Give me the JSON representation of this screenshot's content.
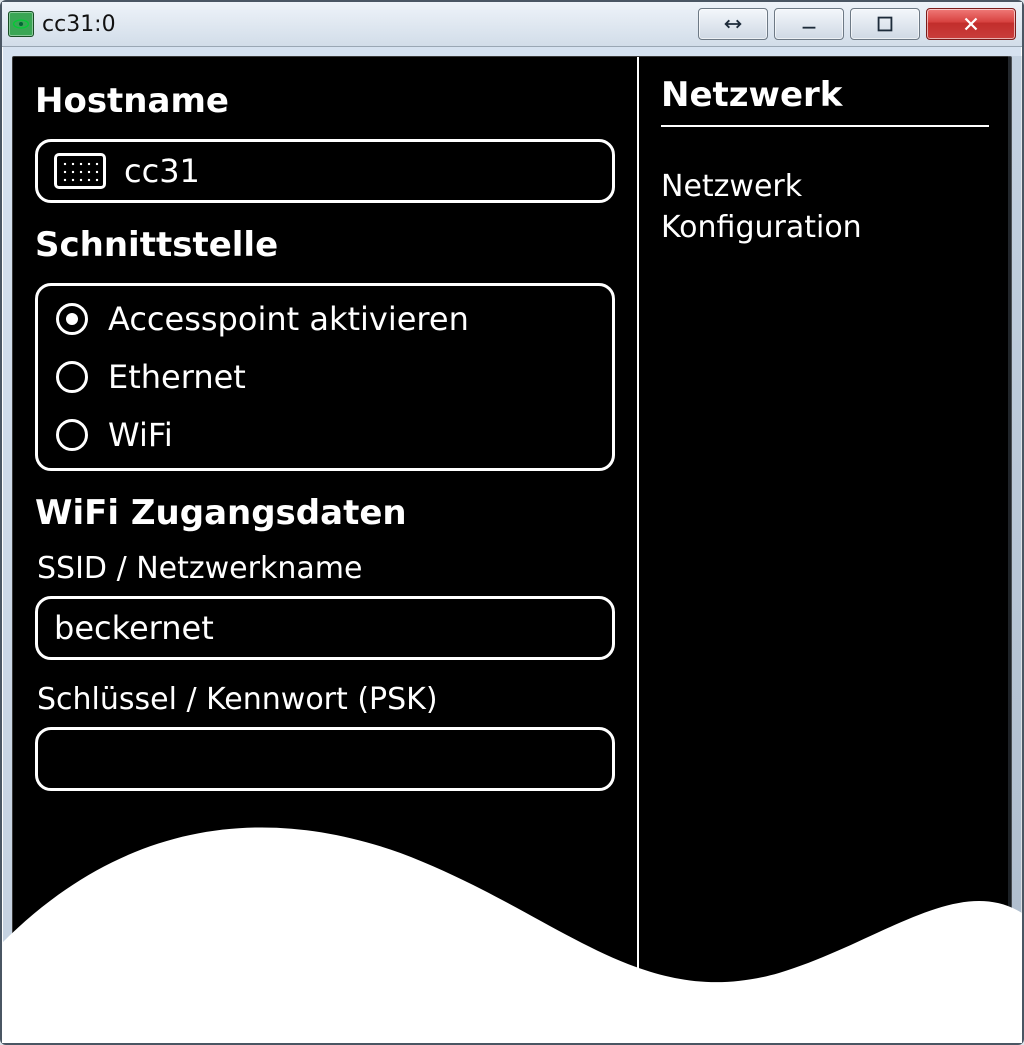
{
  "titlebar": {
    "title": "cc31:0"
  },
  "left": {
    "hostname_heading": "Hostname",
    "hostname_value": "cc31",
    "interface_heading": "Schnittstelle",
    "interfaces": [
      {
        "label": "Accesspoint aktivieren",
        "selected": true
      },
      {
        "label": "Ethernet",
        "selected": false
      },
      {
        "label": "WiFi",
        "selected": false
      }
    ],
    "wifi_heading": "WiFi Zugangsdaten",
    "ssid_label": "SSID / Netzwerkname",
    "ssid_value": "beckernet",
    "psk_label": "Schlüssel / Kennwort (PSK)",
    "psk_value": ""
  },
  "right": {
    "heading": "Netzwerk",
    "description": "Netzwerk Konfiguration"
  }
}
